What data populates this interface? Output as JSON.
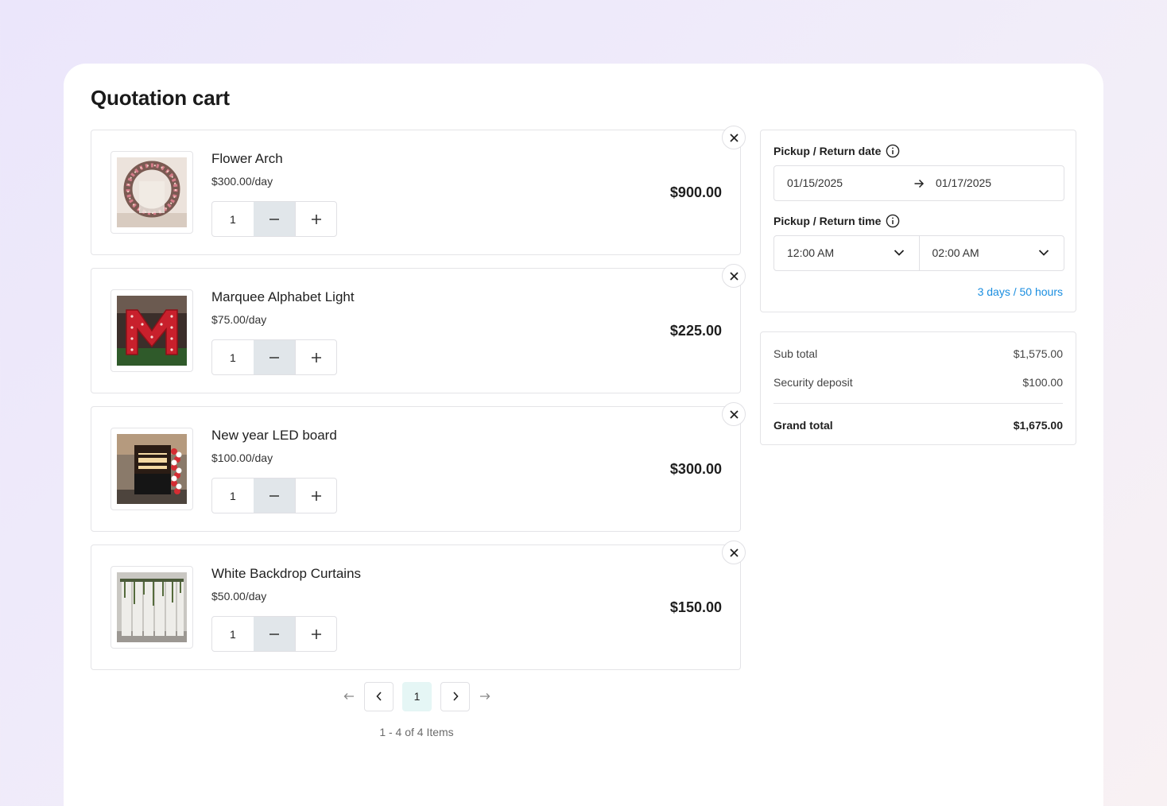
{
  "page": {
    "title": "Quotation cart"
  },
  "items": [
    {
      "name": "Flower Arch",
      "rate": "$300.00/day",
      "qty": "1",
      "total": "$900.00",
      "image": "flower-arch-photo"
    },
    {
      "name": "Marquee Alphabet Light",
      "rate": "$75.00/day",
      "qty": "1",
      "total": "$225.00",
      "image": "marquee-letter-photo"
    },
    {
      "name": "New year LED board",
      "rate": "$100.00/day",
      "qty": "1",
      "total": "$300.00",
      "image": "led-board-photo"
    },
    {
      "name": "White Backdrop Curtains",
      "rate": "$50.00/day",
      "qty": "1",
      "total": "$150.00",
      "image": "backdrop-curtains-photo"
    }
  ],
  "pagination": {
    "current": "1",
    "info": "1 - 4 of 4 Items"
  },
  "schedule": {
    "date_label": "Pickup / Return date",
    "pickup_date": "01/15/2025",
    "return_date": "01/17/2025",
    "time_label": "Pickup / Return time",
    "pickup_time": "12:00 AM",
    "return_time": "02:00 AM",
    "duration": "3 days / 50 hours"
  },
  "summary": {
    "subtotal_label": "Sub total",
    "subtotal": "$1,575.00",
    "deposit_label": "Security deposit",
    "deposit": "$100.00",
    "grand_label": "Grand total",
    "grand": "$1,675.00"
  },
  "icons": [
    "close-icon",
    "minus-icon",
    "plus-icon",
    "chevron-left-icon",
    "chevron-right-icon",
    "arrow-left-icon",
    "arrow-right-icon",
    "info-icon",
    "chevron-down-icon"
  ],
  "colors": {
    "accent_link": "#1a8ee0",
    "minus_bg": "#e1e6ea",
    "active_page_bg": "#e5f6f5"
  }
}
